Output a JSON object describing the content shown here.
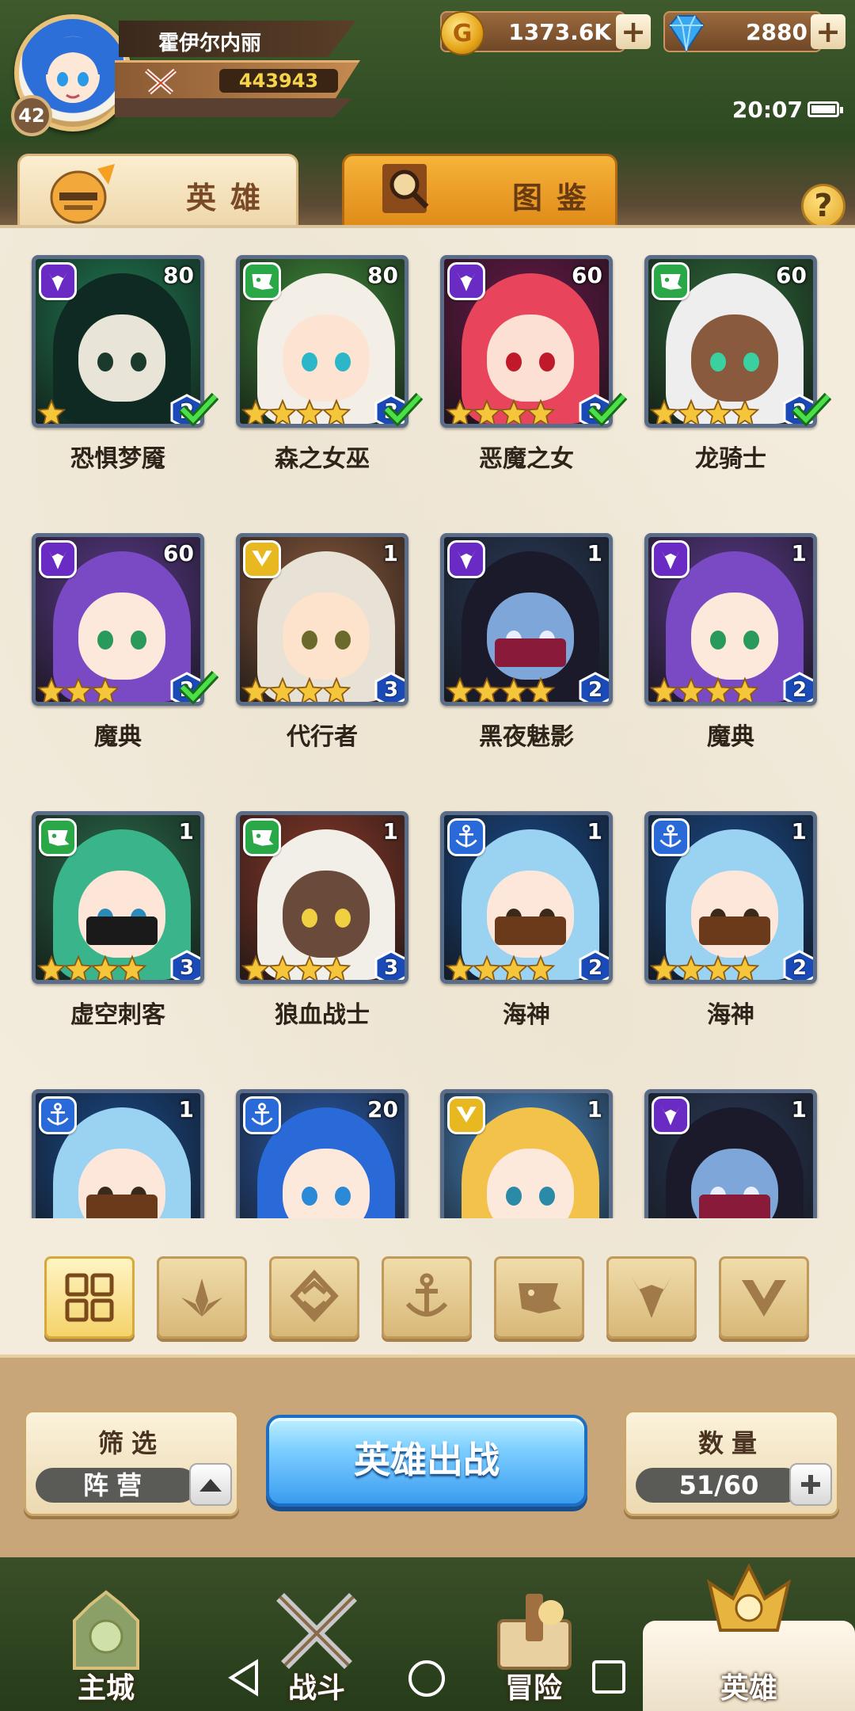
{
  "player": {
    "name": "霍伊尔内丽",
    "power": "443943",
    "level": "42"
  },
  "resources": {
    "gold": "1373.6K",
    "gems": "2880",
    "gold_symbol": "G",
    "plus": "+"
  },
  "status": {
    "time": "20:07"
  },
  "tabs": [
    {
      "label": "英雄"
    },
    {
      "label": "图鉴"
    }
  ],
  "help": "?",
  "heroes": [
    {
      "name": "恐惧梦魇",
      "level": "80",
      "faction": "demon",
      "stars": 1,
      "tier": "2",
      "deployed": true,
      "colors": {
        "bg": "#1f7a52",
        "hair": "#0f2a22",
        "face": "#e8e4d8",
        "eye": "#1b3a2e",
        "mask": ""
      }
    },
    {
      "name": "森之女巫",
      "level": "80",
      "faction": "beast",
      "stars": 4,
      "tier": "3",
      "deployed": true,
      "colors": {
        "bg": "#3f8a3a",
        "hair": "#f4efe6",
        "face": "#fde4d2",
        "eye": "#2bb7c8",
        "mask": ""
      }
    },
    {
      "name": "恶魔之女",
      "level": "60",
      "faction": "demon",
      "stars": 4,
      "tier": "3",
      "deployed": true,
      "colors": {
        "bg": "#6a1a4a",
        "hair": "#e8455c",
        "face": "#fde0d4",
        "eye": "#c01a2a",
        "mask": ""
      }
    },
    {
      "name": "龙骑士",
      "level": "60",
      "faction": "beast",
      "stars": 4,
      "tier": "2",
      "deployed": true,
      "colors": {
        "bg": "#2e6a3a",
        "hair": "#eeeeee",
        "face": "#8a5a3e",
        "eye": "#3bd0a0",
        "mask": ""
      }
    },
    {
      "name": "魔典",
      "level": "60",
      "faction": "demon",
      "stars": 3,
      "tier": "2",
      "deployed": true,
      "colors": {
        "bg": "#5a3a8a",
        "hair": "#7a4ac4",
        "face": "#fde8dc",
        "eye": "#2a9a5a",
        "mask": ""
      }
    },
    {
      "name": "代行者",
      "level": "1",
      "faction": "light",
      "stars": 4,
      "tier": "3",
      "deployed": false,
      "colors": {
        "bg": "#8a5a3e",
        "hair": "#e8e2d6",
        "face": "#fde2cc",
        "eye": "#6a6a2a",
        "mask": ""
      }
    },
    {
      "name": "黑夜魅影",
      "level": "1",
      "faction": "demon",
      "stars": 4,
      "tier": "2",
      "deployed": false,
      "colors": {
        "bg": "#2a3a5a",
        "hair": "#1a1a2a",
        "face": "#7fa6d8",
        "eye": "#e8f0ff",
        "mask": "#8a1a3a"
      }
    },
    {
      "name": "魔典",
      "level": "1",
      "faction": "demon",
      "stars": 4,
      "tier": "2",
      "deployed": false,
      "colors": {
        "bg": "#5a3a8a",
        "hair": "#7a4ac4",
        "face": "#fde8dc",
        "eye": "#2a9a5a",
        "mask": ""
      }
    },
    {
      "name": "虚空刺客",
      "level": "1",
      "faction": "beast",
      "stars": 4,
      "tier": "3",
      "deployed": false,
      "colors": {
        "bg": "#2a6a4a",
        "hair": "#3ab48a",
        "face": "#fde6d8",
        "eye": "#2a8ab8",
        "mask": "#1a1a1a"
      }
    },
    {
      "name": "狼血战士",
      "level": "1",
      "faction": "beast",
      "stars": 4,
      "tier": "3",
      "deployed": false,
      "colors": {
        "bg": "#8a3a2a",
        "hair": "#f2eee8",
        "face": "#6a4a3a",
        "eye": "#f0d040",
        "mask": ""
      }
    },
    {
      "name": "海神",
      "level": "1",
      "faction": "sea",
      "stars": 4,
      "tier": "2",
      "deployed": false,
      "colors": {
        "bg": "#1a4a8a",
        "hair": "#9ad2f2",
        "face": "#fde6da",
        "eye": "#3a2a1a",
        "mask": "#6a3a1a"
      }
    },
    {
      "name": "海神",
      "level": "1",
      "faction": "sea",
      "stars": 4,
      "tier": "2",
      "deployed": false,
      "colors": {
        "bg": "#1a4a8a",
        "hair": "#9ad2f2",
        "face": "#fde6da",
        "eye": "#3a2a1a",
        "mask": "#6a3a1a"
      }
    },
    {
      "name": "",
      "level": "1",
      "faction": "sea",
      "stars": 0,
      "tier": "",
      "deployed": false,
      "colors": {
        "bg": "#1a4a8a",
        "hair": "#9ad2f2",
        "face": "#fde6da",
        "eye": "#3a2a1a",
        "mask": "#6a3a1a"
      }
    },
    {
      "name": "",
      "level": "20",
      "faction": "sea",
      "stars": 0,
      "tier": "",
      "deployed": false,
      "colors": {
        "bg": "#2a5aa8",
        "hair": "#2a6ad8",
        "face": "#fde8dc",
        "eye": "#2a8ad8",
        "mask": ""
      }
    },
    {
      "name": "",
      "level": "1",
      "faction": "light",
      "stars": 0,
      "tier": "",
      "deployed": false,
      "colors": {
        "bg": "#4a8ac8",
        "hair": "#f2c24a",
        "face": "#fde8dc",
        "eye": "#2a8aa8",
        "mask": ""
      }
    },
    {
      "name": "",
      "level": "1",
      "faction": "demon",
      "stars": 0,
      "tier": "",
      "deployed": false,
      "colors": {
        "bg": "#2a3a5a",
        "hair": "#1a1a2a",
        "face": "#7fa6d8",
        "eye": "#e8f0ff",
        "mask": "#8a1a3a"
      }
    }
  ],
  "faction_colors": {
    "demon": "#6a2ac4",
    "beast": "#2aa848",
    "sea": "#2a6ad8",
    "light": "#e8b820"
  },
  "filter_tabs": [
    "all-icon",
    "nature-icon",
    "element-icon",
    "anchor-icon",
    "beast-icon",
    "demon-icon",
    "light-icon"
  ],
  "bottom": {
    "filter_title": "筛选",
    "filter_value": "阵营",
    "deploy": "英雄出战",
    "count_title": "数量",
    "count_value": "51/60"
  },
  "nav": [
    {
      "label": "主城",
      "icon": "castle-icon"
    },
    {
      "label": "战斗",
      "icon": "crossed-swords-icon"
    },
    {
      "label": "冒险",
      "icon": "map-scroll-icon"
    },
    {
      "label": "英雄",
      "icon": "hero-crest-icon"
    }
  ]
}
